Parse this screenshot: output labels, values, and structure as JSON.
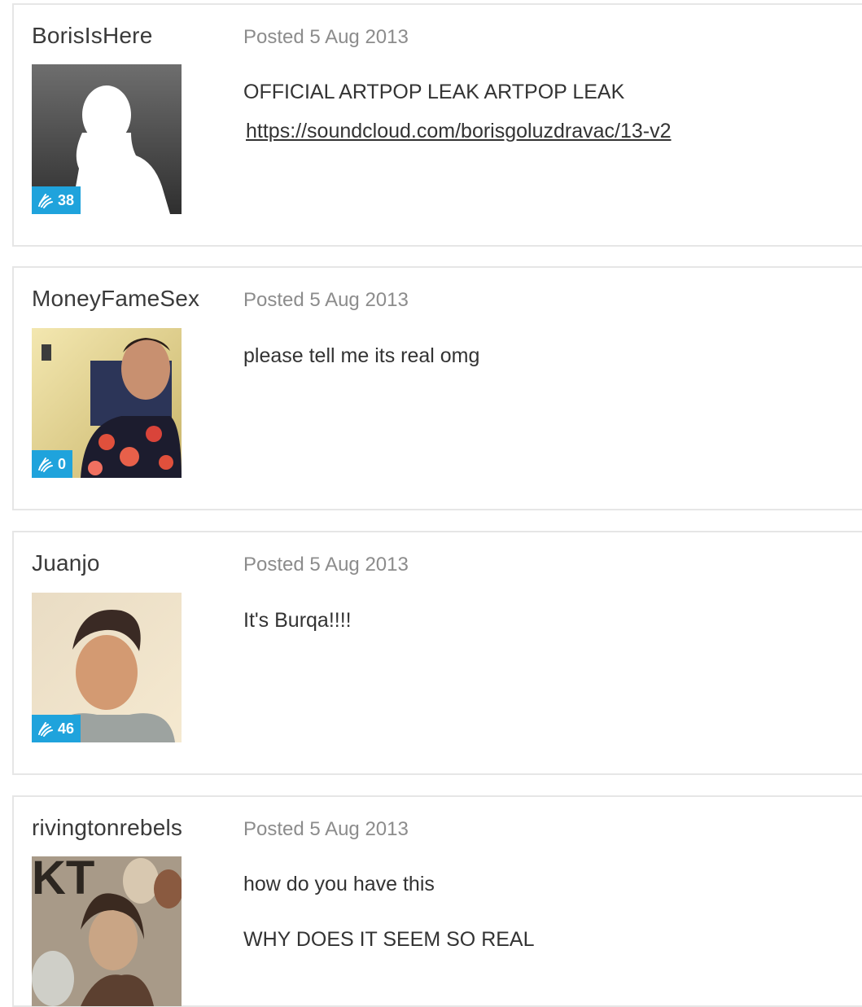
{
  "posts": [
    {
      "username": "BorisIsHere",
      "posted": "Posted 5 Aug 2013",
      "reputation": "38",
      "avatar_icon": "default-silhouette-avatar",
      "lines": [
        "OFFICIAL ARTPOP LEAK ARTPOP LEAK"
      ],
      "link": "https://soundcloud.com/borisgoluzdravac/13-v2"
    },
    {
      "username": "MoneyFameSex",
      "posted": "Posted 5 Aug 2013",
      "reputation": "0",
      "avatar_icon": "user-photo",
      "lines": [
        "please tell me its real omg"
      ]
    },
    {
      "username": "Juanjo",
      "posted": "Posted 5 Aug 2013",
      "reputation": "46",
      "avatar_icon": "user-photo",
      "lines": [
        "It's Burqa!!!!"
      ]
    },
    {
      "username": "rivingtonrebels",
      "posted": "Posted 5 Aug 2013",
      "reputation": "",
      "avatar_icon": "album-collage-photo",
      "lines": [
        "how do you have this",
        "WHY DOES IT SEEM SO REAL"
      ]
    }
  ],
  "colors": {
    "badge": "#1fa3dc",
    "border": "#e6e6e6",
    "meta_text": "#8c8c8c"
  }
}
